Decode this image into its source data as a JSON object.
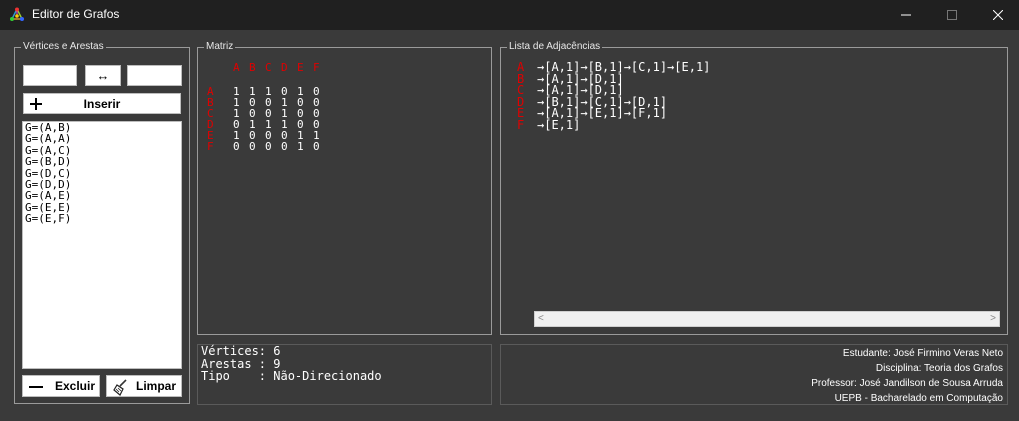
{
  "window": {
    "title": "Editor de Grafos",
    "controls": {
      "minimize": "—",
      "maximize": "☐",
      "close": "✕"
    }
  },
  "vertices_group": {
    "legend": "Vértices e Arestas",
    "from_value": "",
    "swap_symbol": "↔",
    "to_value": "",
    "insert_label": "Inserir",
    "edges": [
      "G=(A,B)",
      "G=(A,A)",
      "G=(A,C)",
      "G=(B,D)",
      "G=(D,C)",
      "G=(D,D)",
      "G=(A,E)",
      "G=(E,E)",
      "G=(E,F)"
    ],
    "delete_label": "Excluir",
    "clear_label": "Limpar"
  },
  "matrix_group": {
    "legend": "Matriz",
    "headers": [
      "A",
      "B",
      "C",
      "D",
      "E",
      "F"
    ],
    "rows": [
      {
        "label": "A",
        "values": [
          "1",
          "1",
          "1",
          "0",
          "1",
          "0"
        ]
      },
      {
        "label": "B",
        "values": [
          "1",
          "0",
          "0",
          "1",
          "0",
          "0"
        ]
      },
      {
        "label": "C",
        "values": [
          "1",
          "0",
          "0",
          "1",
          "0",
          "0"
        ]
      },
      {
        "label": "D",
        "values": [
          "0",
          "1",
          "1",
          "1",
          "0",
          "0"
        ]
      },
      {
        "label": "E",
        "values": [
          "1",
          "0",
          "0",
          "0",
          "1",
          "1"
        ]
      },
      {
        "label": "F",
        "values": [
          "0",
          "0",
          "0",
          "0",
          "1",
          "0"
        ]
      }
    ]
  },
  "adjacency_group": {
    "legend": "Lista de Adjacências",
    "rows": [
      {
        "vertex": "A",
        "list": "→[A,1]→[B,1]→[C,1]→[E,1]"
      },
      {
        "vertex": "B",
        "list": "→[A,1]→[D,1]"
      },
      {
        "vertex": "C",
        "list": "→[A,1]→[D,1]"
      },
      {
        "vertex": "D",
        "list": "→[B,1]→[C,1]→[D,1]"
      },
      {
        "vertex": "E",
        "list": "→[A,1]→[E,1]→[F,1]"
      },
      {
        "vertex": "F",
        "list": "→[E,1]"
      }
    ],
    "scroll_left": "<",
    "scroll_right": ">"
  },
  "info": {
    "vertices": "Vértices: 6",
    "edges": "Arestas : 9",
    "type": "Tipo    : Não-Direcionado"
  },
  "credits": {
    "student": "Estudante: José Firmino Veras Neto",
    "course": "Disciplina: Teoria dos Grafos",
    "professor": "Professor: José Jandilson de Sousa Arruda",
    "institution": "UEPB - Bacharelado em Computação"
  },
  "colors": {
    "vertex_label": "#e00000",
    "background": "#3a3a3a",
    "titlebar": "#202020"
  }
}
